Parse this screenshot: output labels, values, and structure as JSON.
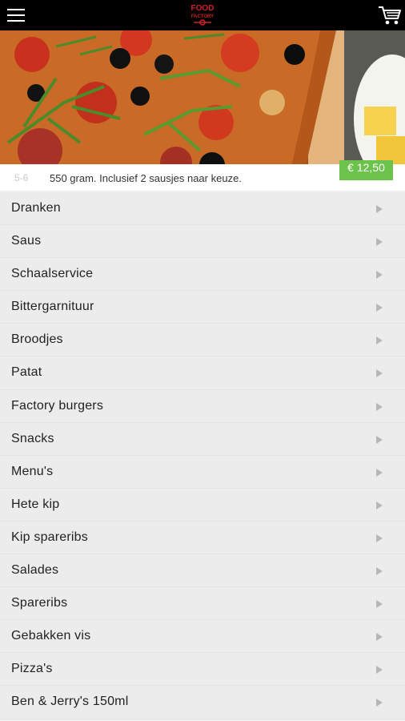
{
  "header": {
    "menu_icon": "hamburger-menu-icon",
    "logo": {
      "line1": "FOOD",
      "line2": "FACTORY"
    },
    "cart_icon": "shopping-cart-icon"
  },
  "promo": {
    "number_partial": "5-6",
    "description": "550 gram. Inclusief 2 sausjes naar keuze.",
    "price": "€ 12,50"
  },
  "categories": [
    "Dranken",
    "Saus",
    "Schaalservice",
    "Bittergarnituur",
    "Broodjes",
    "Patat",
    "Factory burgers",
    "Snacks",
    "Menu's",
    "Hete kip",
    "Kip spareribs",
    "Salades",
    "Spareribs",
    "Gebakken vis",
    "Pizza's",
    "Ben & Jerry's 150ml"
  ],
  "colors": {
    "topbar": "#000000",
    "price_badge": "#6cc24a",
    "list_bg": "#ececec",
    "logo_red": "#d0202a"
  }
}
